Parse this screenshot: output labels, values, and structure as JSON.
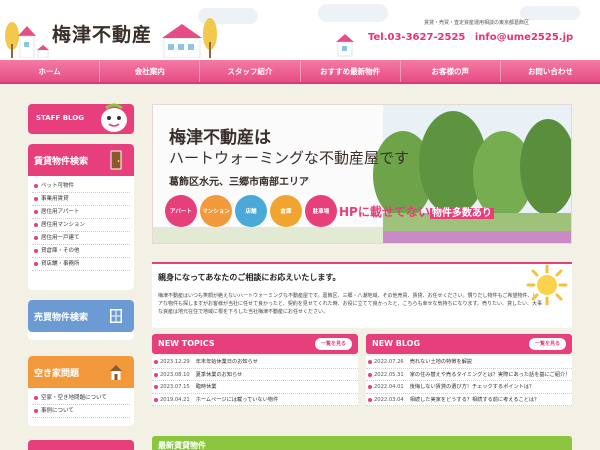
{
  "header": {
    "site_title": "梅津不動産",
    "tagline": "賃貸・売買・査定資産運用相談の東京都葛飾区",
    "phone": "Tel.03-3627-2525",
    "email": "info@ume2525.jp"
  },
  "nav": {
    "items": [
      "ホーム",
      "会社案内",
      "スタッフ紹介",
      "おすすめ最新物件",
      "お客様の声",
      "お問い合わせ"
    ]
  },
  "sidebar": {
    "staff_blog": "STAFF BLOG",
    "rent": {
      "title": "賃貸物件検索",
      "items": [
        "ペット可物件",
        "事業用賃貸",
        "居住用アパート",
        "居住用マンション",
        "居住用一戸建て",
        "貸倉庫・その他",
        "貸店舗・事務所"
      ]
    },
    "sale": {
      "title": "売買物件検索"
    },
    "vacant": {
      "title": "空き家問題",
      "items": [
        "空家・空き地問題について",
        "事例について"
      ]
    }
  },
  "hero": {
    "title1": "梅津不動産は",
    "title2": "ハートウォーミングな不動産屋です",
    "area": "葛飾区水元、三郷市南部エリア",
    "categories": [
      {
        "label": "アパート",
        "color": "#e63f7c"
      },
      {
        "label": "マンション",
        "color": "#f29a3b"
      },
      {
        "label": "店舗",
        "color": "#4aa9d6"
      },
      {
        "label": "倉庫",
        "color": "#f0a530"
      },
      {
        "label": "駐車場",
        "color": "#e63f7c"
      }
    ],
    "banner_prefix": "HPに載せてない",
    "banner_highlight": "物件多数あり"
  },
  "intro": {
    "title": "親身になってあなたのご相談にお応えいたします。",
    "text": "梅津不動産はいつも笑顔が絶えないハートウォーミングな不動産屋です。葛飾区、三郷・八潮地域、その他売買、賃貸、お任せください。慣りだし物件もご希望物件、レアな物件も探しますがお客様が当社に任せて良かったと、契約を見せてくれた時、お役に立てて良かったと、こちらも幸せな気持ちになります。売りたい、貸したい、大事な資産は地元在住で地域に根を下ろした当社梅津不動産にお任せください。"
  },
  "new_topics": {
    "title": "NEW TOPICS",
    "more": "一覧を見る",
    "items": [
      {
        "date": "2023.12.29",
        "text": "年末年始休業日のお知らせ"
      },
      {
        "date": "2023.08.10",
        "text": "夏季休業のお知らせ"
      },
      {
        "date": "2023.07.15",
        "text": "臨時休業"
      },
      {
        "date": "2019.04.21",
        "text": "ホームページには載っていない物件"
      }
    ]
  },
  "new_blog": {
    "title": "NEW BLOG",
    "more": "一覧を見る",
    "items": [
      {
        "date": "2022.07.26",
        "text": "売れない土地の特徴を解説"
      },
      {
        "date": "2022.05.31",
        "text": "家の住み替えや売るタイミングとは？実際にあった話を基にご紹介！"
      },
      {
        "date": "2022.04.01",
        "text": "後悔しない賃貸の選び方！チェックするポイントは？"
      },
      {
        "date": "2022.03.04",
        "text": "相続した実家をどうする？相続する前に考えることは？"
      }
    ]
  },
  "recent_rent": {
    "title": "最新賃貸物件"
  }
}
